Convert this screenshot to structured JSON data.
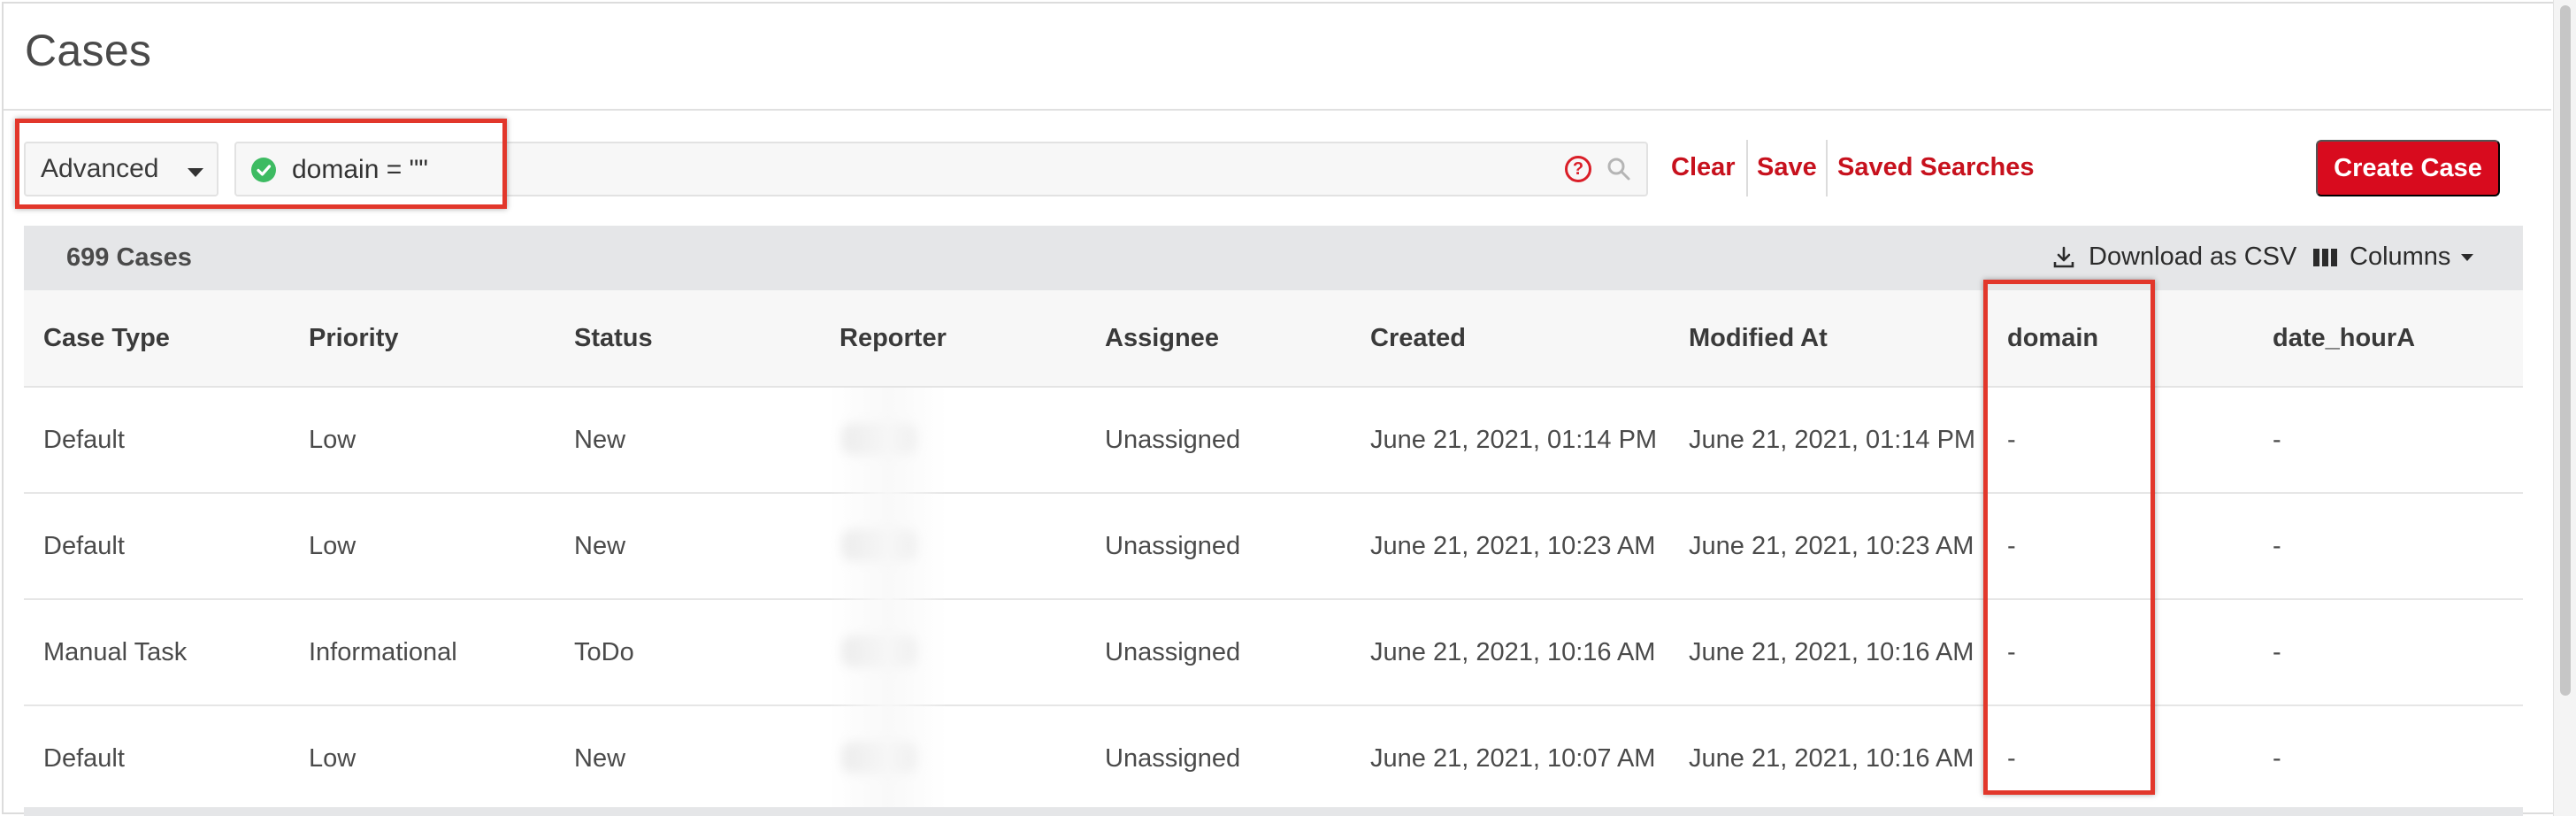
{
  "page": {
    "title": "Cases"
  },
  "search": {
    "mode": "Advanced",
    "query": "domain = \"\"",
    "help_glyph": "?",
    "actions": {
      "clear": "Clear",
      "save": "Save",
      "saved_searches": "Saved Searches"
    },
    "create_case": "Create Case"
  },
  "table": {
    "count_label": "699 Cases",
    "download_label": "Download as CSV",
    "columns_label": "Columns",
    "headers": [
      "Case Type",
      "Priority",
      "Status",
      "Reporter",
      "Assignee",
      "Created",
      "Modified At",
      "domain",
      "date_hourA"
    ],
    "rows": [
      {
        "case_type": "Default",
        "priority": "Low",
        "status": "New",
        "assignee": "Unassigned",
        "created": "June 21, 2021, 01:14 PM",
        "modified": "June 21, 2021, 01:14 PM",
        "domain": "-",
        "date_hour": "-"
      },
      {
        "case_type": "Default",
        "priority": "Low",
        "status": "New",
        "assignee": "Unassigned",
        "created": "June 21, 2021, 10:23 AM",
        "modified": "June 21, 2021, 10:23 AM",
        "domain": "-",
        "date_hour": "-"
      },
      {
        "case_type": "Manual Task",
        "priority": "Informational",
        "status": "ToDo",
        "assignee": "Unassigned",
        "created": "June 21, 2021, 10:16 AM",
        "modified": "June 21, 2021, 10:16 AM",
        "domain": "-",
        "date_hour": "-"
      },
      {
        "case_type": "Default",
        "priority": "Low",
        "status": "New",
        "assignee": "Unassigned",
        "created": "June 21, 2021, 10:07 AM",
        "modified": "June 21, 2021, 10:16 AM",
        "domain": "-",
        "date_hour": "-"
      }
    ]
  },
  "colors": {
    "accent": "#da1e28",
    "valid": "#3dbb62",
    "highlight": "#e2372b"
  },
  "icons": [
    "chevron-down-icon",
    "check-circle-icon",
    "help-icon",
    "search-icon",
    "download-icon",
    "columns-icon"
  ]
}
